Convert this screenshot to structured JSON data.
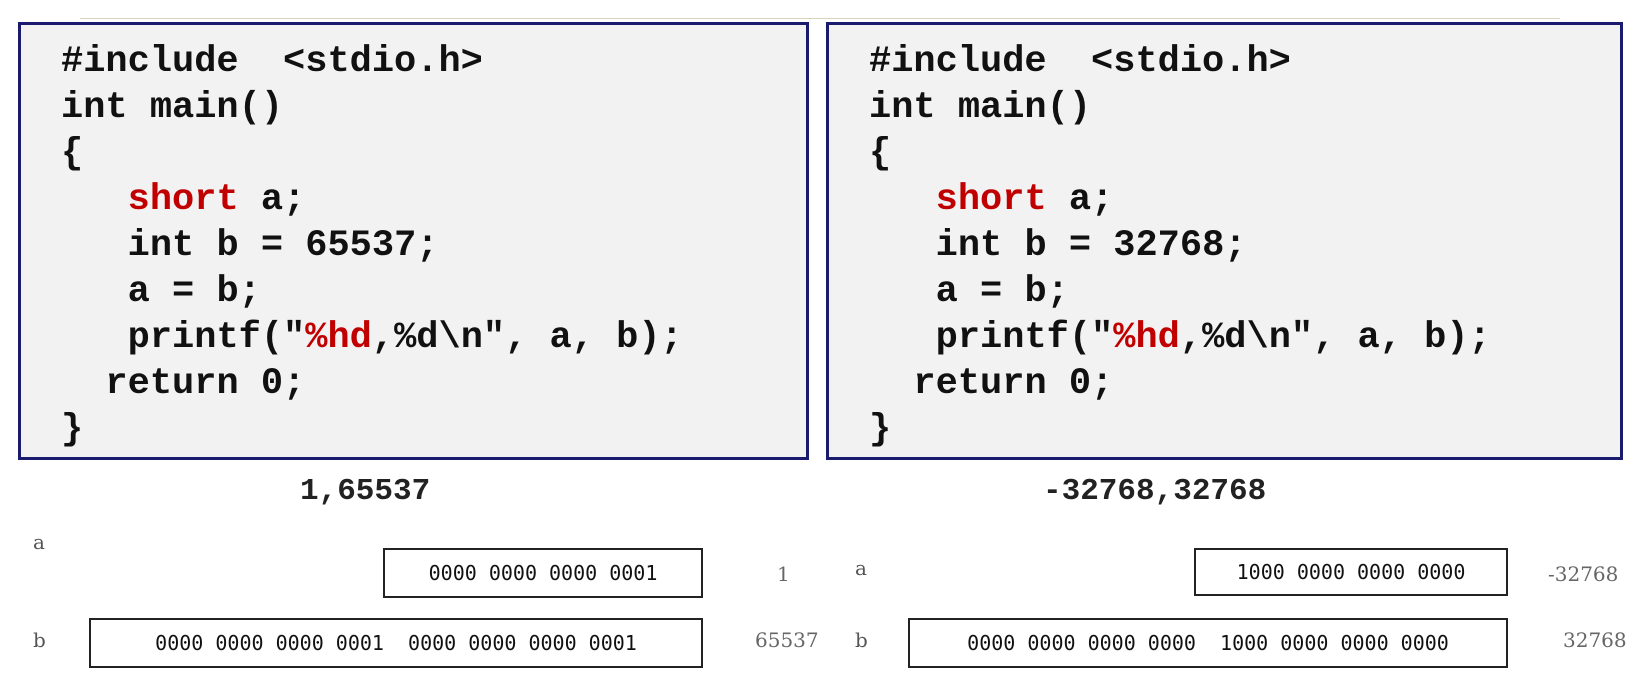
{
  "left": {
    "code": {
      "line1": "#include  <stdio.h>",
      "line2": "int main()",
      "line3": "{",
      "line4_kw": "short",
      "line4_rest": " a;",
      "line5": "int b = 65537;",
      "line6": "a = b;",
      "line7_pre": "printf(\"",
      "line7_kw": "%hd",
      "line7_post": ",%d\\n\", a, b);",
      "line8": "return 0;",
      "line9": "}"
    },
    "output": "1,65537",
    "memory": {
      "a_label": "a",
      "a_bits": "0000 0000 0000 0001",
      "a_value": "1",
      "b_label": "b",
      "b_bits": "0000 0000 0000 0001  0000 0000 0000 0001",
      "b_value": "65537"
    }
  },
  "right": {
    "code": {
      "line1": "#include  <stdio.h>",
      "line2": "int main()",
      "line3": "{",
      "line4_kw": "short",
      "line4_rest": " a;",
      "line5": "int b = 32768;",
      "line6": "a = b;",
      "line7_pre": "printf(\"",
      "line7_kw": "%hd",
      "line7_post": ",%d\\n\", a, b);",
      "line8": "return 0;",
      "line9": "}"
    },
    "output": "-32768,32768",
    "memory": {
      "a_label": "a",
      "a_bits": "1000 0000 0000 0000",
      "a_value": "-32768",
      "b_label": "b",
      "b_bits": "0000 0000 0000 0000  1000 0000 0000 0000",
      "b_value": "32768"
    }
  },
  "colors": {
    "keyword": "#c00000",
    "box_border": "#1a1a6e",
    "box_bg": "#f2f2f2"
  }
}
